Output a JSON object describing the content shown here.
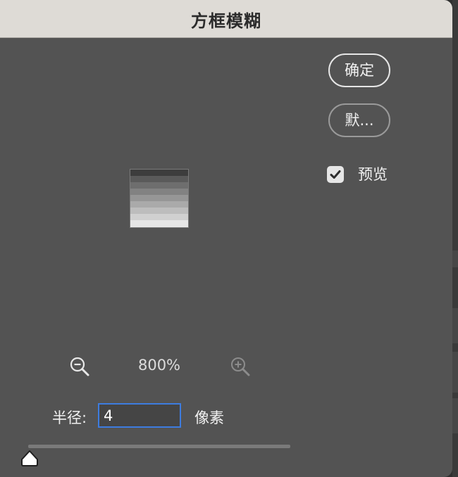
{
  "dialog": {
    "title": "方框模糊"
  },
  "buttons": {
    "ok_label": "确定",
    "default_label": "默..."
  },
  "preview": {
    "label": "预览",
    "checked": true
  },
  "zoom": {
    "level": "800%",
    "zoom_out_icon": "zoom-out-icon",
    "zoom_in_icon": "zoom-in-icon"
  },
  "radius": {
    "label": "半径:",
    "value": "4",
    "unit": "像素",
    "slider_fraction": 0.0
  },
  "colors": {
    "dialog_bg": "#535353",
    "titlebar_bg": "#dedbd6",
    "input_focus": "#3d7ce0"
  }
}
